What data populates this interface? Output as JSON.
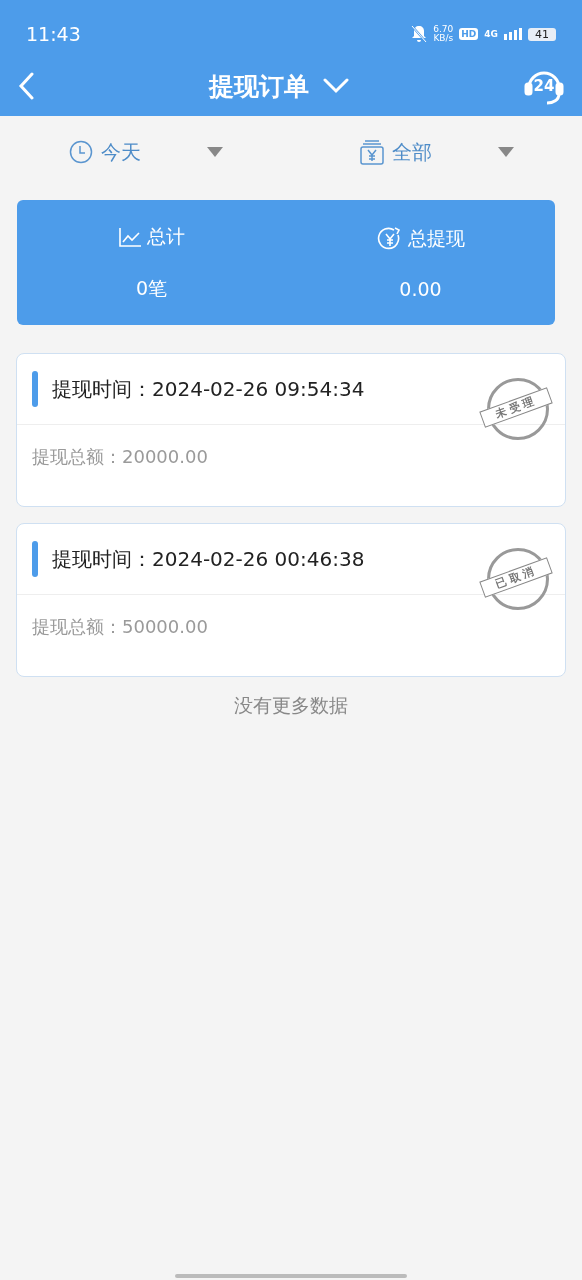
{
  "status_bar": {
    "time": "11:43",
    "speed_value": "6.70",
    "speed_unit": "KB/s",
    "hd": "HD",
    "network": "4G",
    "battery": "41"
  },
  "nav": {
    "title": "提现订单",
    "support_badge": "24"
  },
  "filters": [
    {
      "label": "今天",
      "kind": "clock"
    },
    {
      "label": "全部",
      "kind": "wallet"
    }
  ],
  "summary": [
    {
      "label": "总计",
      "value": "0笔",
      "kind": "chart"
    },
    {
      "label": "总提现",
      "value": "0.00",
      "kind": "money"
    }
  ],
  "orders": [
    {
      "time_label": "提现时间：",
      "time": "2024-02-26 09:54:34",
      "amount_label": "提现总额：",
      "amount": "20000.00",
      "stamp": "未受理"
    },
    {
      "time_label": "提现时间：",
      "time": "2024-02-26 00:46:38",
      "amount_label": "提现总额：",
      "amount": "50000.00",
      "stamp": "已取消"
    }
  ],
  "footer": "没有更多数据"
}
